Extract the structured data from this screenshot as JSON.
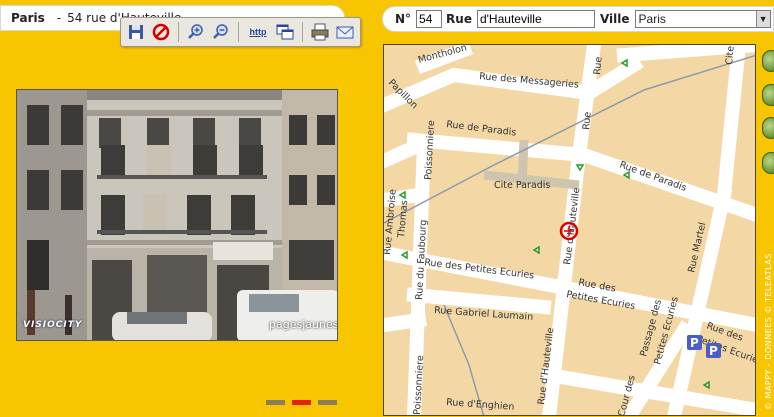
{
  "location": {
    "city": "Paris",
    "separator": "-",
    "address": "54 rue d'Hauteville"
  },
  "toolbar": {
    "buttons": [
      {
        "name": "save",
        "icon": "floppy-disk-icon"
      },
      {
        "name": "cancel",
        "icon": "no-entry-icon"
      },
      {
        "name": "zoom-in",
        "icon": "zoom-in-icon"
      },
      {
        "name": "zoom-out",
        "icon": "zoom-out-icon"
      },
      {
        "name": "http",
        "label": "http"
      },
      {
        "name": "windows",
        "icon": "windows-icon"
      },
      {
        "name": "print",
        "icon": "print-icon"
      },
      {
        "name": "email",
        "icon": "envelope-icon"
      }
    ]
  },
  "photo": {
    "logo_left": "VISIOCITY",
    "logo_right": "pagesjaunes"
  },
  "search": {
    "number_label": "N°",
    "number_value": "54",
    "street_label": "Rue",
    "street_value": "d'Hauteville",
    "city_label": "Ville",
    "city_value": "Paris"
  },
  "map": {
    "streets": {
      "montholon": "Montholon",
      "messageries": "Rue des Messageries",
      "papillon": "Papillon",
      "paradis_left": "Rue de Paradis",
      "paradis_right": "Rue de Paradis",
      "cite_paradis": "Cite Paradis",
      "poissonniere_top": "Poissonniere",
      "ambroise": "Rue Ambroise",
      "thomas": "Thomas",
      "hauteville": "Rue d'Hauteville",
      "hauteville_low": "Rue d'Hauteville",
      "martel": "Rue Martel",
      "faubourg": "Rue du Faubourg",
      "petites_ecuries_left": "Rue des Petites Ecuries",
      "petites_ecuries_mid1": "Rue des",
      "petites_ecuries_mid2": "Petites Ecuries",
      "gabriel": "Rue Gabriel Laumain",
      "passage": "Passage des",
      "passage2": "Petites Ecuries",
      "ecuries_right1": "Rue des",
      "ecuries_right2": "Petites Ecuries",
      "cour_des": "Cour des",
      "enghien": "Rue d'Enghien",
      "poissonniere_bottom": "Poissonniere",
      "rue_top_right": "Rue",
      "cite_top_right": "Cite",
      "rue_mid": "Rue"
    },
    "parking_label": "P"
  },
  "copyright": "© MAPPY - DONNEES © TELEATLAS",
  "pager": {
    "count": 3,
    "active": 1
  }
}
